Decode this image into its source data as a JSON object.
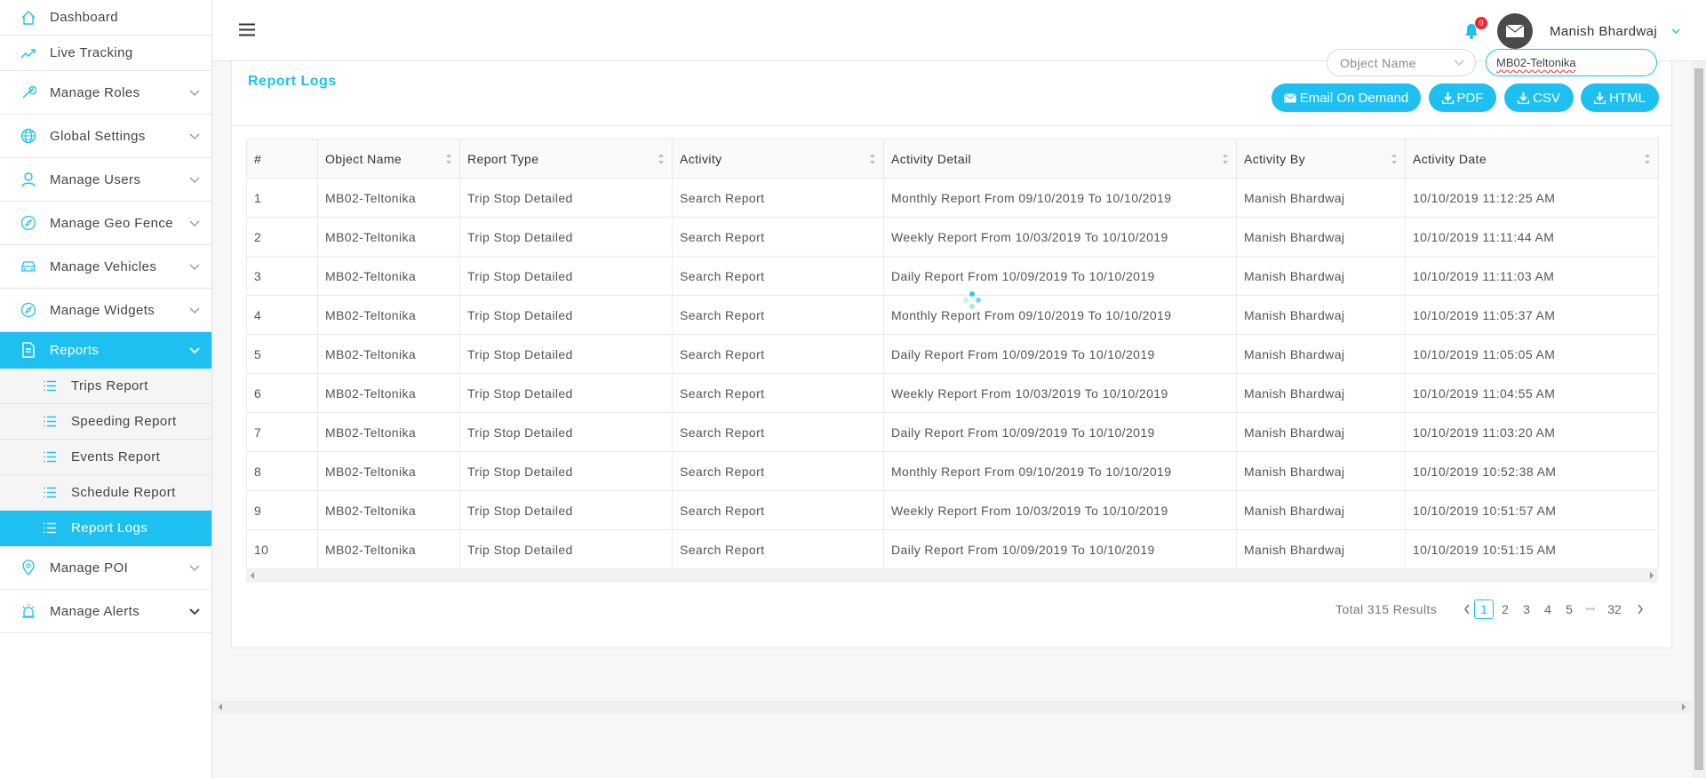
{
  "sidebar": {
    "items": [
      {
        "label": "Dashboard"
      },
      {
        "label": "Live Tracking"
      },
      {
        "label": "Manage Roles"
      },
      {
        "label": "Global Settings"
      },
      {
        "label": "Manage Users"
      },
      {
        "label": "Manage Geo Fence"
      },
      {
        "label": "Manage Vehicles"
      },
      {
        "label": "Manage Widgets"
      },
      {
        "label": "Reports"
      },
      {
        "label": "Manage POI"
      },
      {
        "label": "Manage Alerts"
      }
    ],
    "sub_items": [
      {
        "label": "Trips Report"
      },
      {
        "label": "Speeding Report"
      },
      {
        "label": "Events Report"
      },
      {
        "label": "Schedule Report"
      },
      {
        "label": "Report Logs"
      }
    ]
  },
  "header": {
    "notification_count": "0",
    "user_name": "Manish Bhardwaj"
  },
  "card": {
    "title": "Report Logs",
    "object_select_placeholder": "Object Name",
    "object_input_value": "MB02-Teltonika",
    "buttons": {
      "email": "Email On Demand",
      "pdf": "PDF",
      "csv": "CSV",
      "html": "HTML"
    }
  },
  "table": {
    "columns": [
      "#",
      "Object Name",
      "Report Type",
      "Activity",
      "Activity Detail",
      "Activity By",
      "Activity Date"
    ],
    "rows": [
      [
        "1",
        "MB02-Teltonika",
        "Trip Stop Detailed",
        "Search Report",
        "Monthly Report From 09/10/2019 To 10/10/2019",
        "Manish Bhardwaj",
        "10/10/2019 11:12:25 AM"
      ],
      [
        "2",
        "MB02-Teltonika",
        "Trip Stop Detailed",
        "Search Report",
        "Weekly Report From 10/03/2019 To 10/10/2019",
        "Manish Bhardwaj",
        "10/10/2019 11:11:44 AM"
      ],
      [
        "3",
        "MB02-Teltonika",
        "Trip Stop Detailed",
        "Search Report",
        "Daily Report From 10/09/2019 To 10/10/2019",
        "Manish Bhardwaj",
        "10/10/2019 11:11:03 AM"
      ],
      [
        "4",
        "MB02-Teltonika",
        "Trip Stop Detailed",
        "Search Report",
        "Monthly Report From 09/10/2019 To 10/10/2019",
        "Manish Bhardwaj",
        "10/10/2019 11:05:37 AM"
      ],
      [
        "5",
        "MB02-Teltonika",
        "Trip Stop Detailed",
        "Search Report",
        "Daily Report From 10/09/2019 To 10/10/2019",
        "Manish Bhardwaj",
        "10/10/2019 11:05:05 AM"
      ],
      [
        "6",
        "MB02-Teltonika",
        "Trip Stop Detailed",
        "Search Report",
        "Weekly Report From 10/03/2019 To 10/10/2019",
        "Manish Bhardwaj",
        "10/10/2019 11:04:55 AM"
      ],
      [
        "7",
        "MB02-Teltonika",
        "Trip Stop Detailed",
        "Search Report",
        "Daily Report From 10/09/2019 To 10/10/2019",
        "Manish Bhardwaj",
        "10/10/2019 11:03:20 AM"
      ],
      [
        "8",
        "MB02-Teltonika",
        "Trip Stop Detailed",
        "Search Report",
        "Monthly Report From 09/10/2019 To 10/10/2019",
        "Manish Bhardwaj",
        "10/10/2019 10:52:38 AM"
      ],
      [
        "9",
        "MB02-Teltonika",
        "Trip Stop Detailed",
        "Search Report",
        "Weekly Report From 10/03/2019 To 10/10/2019",
        "Manish Bhardwaj",
        "10/10/2019 10:51:57 AM"
      ],
      [
        "10",
        "MB02-Teltonika",
        "Trip Stop Detailed",
        "Search Report",
        "Daily Report From 10/09/2019 To 10/10/2019",
        "Manish Bhardwaj",
        "10/10/2019 10:51:15 AM"
      ]
    ]
  },
  "pagination": {
    "total_text": "Total 315 Results",
    "pages": [
      "1",
      "2",
      "3",
      "4",
      "5"
    ],
    "ellipsis": "•••",
    "last_page": "32",
    "current_page": "1"
  },
  "colors": {
    "accent": "#1ec0f2",
    "badge": "#f5222d"
  }
}
